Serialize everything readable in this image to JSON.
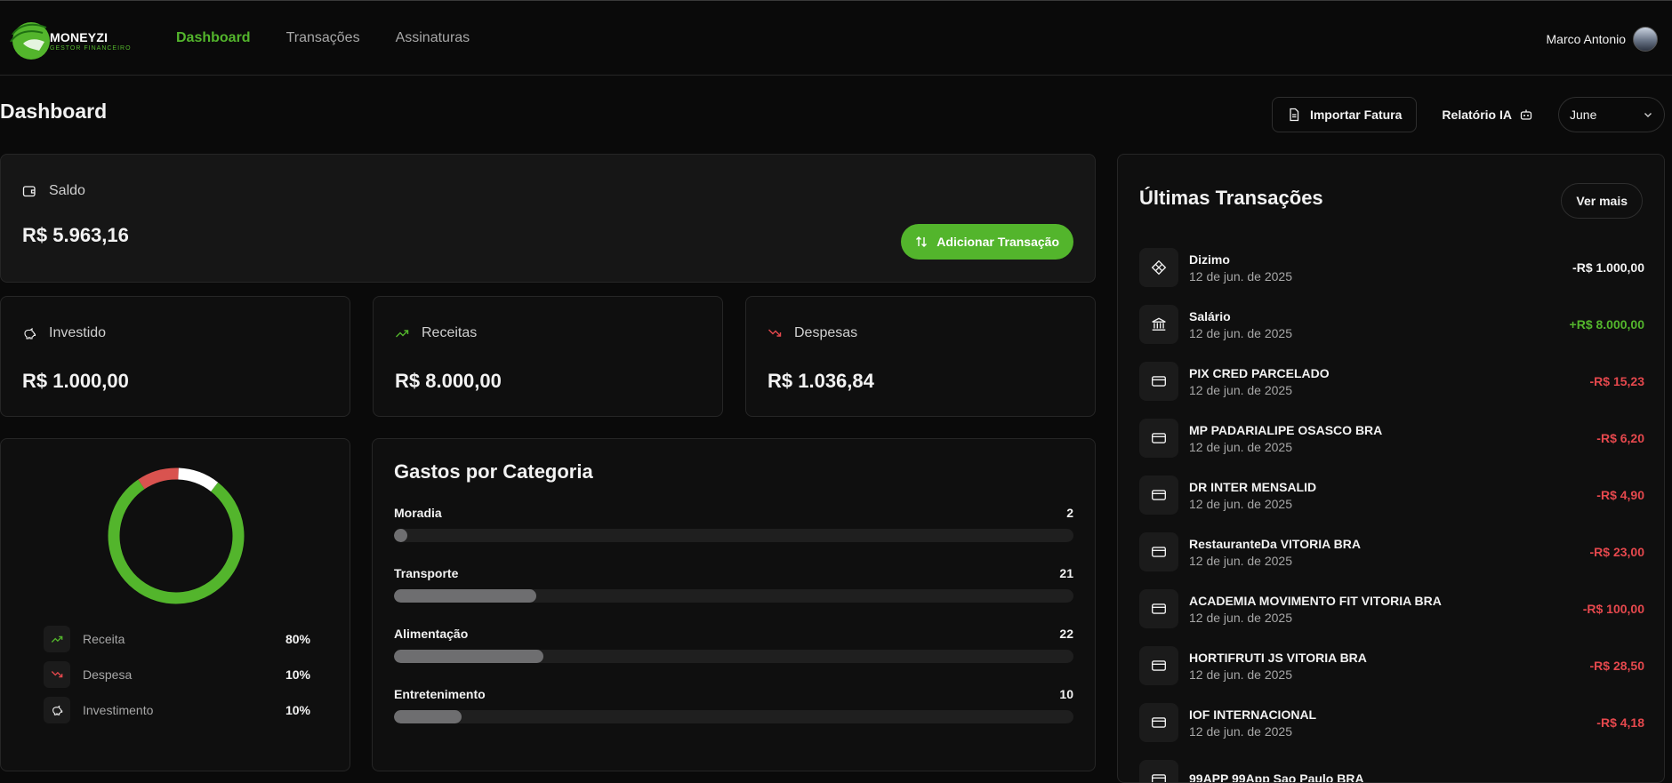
{
  "brand": {
    "name": "MONEYZI",
    "tagline": "GESTOR FINANCEIRO"
  },
  "nav": [
    {
      "label": "Dashboard",
      "active": true
    },
    {
      "label": "Transações",
      "active": false
    },
    {
      "label": "Assinaturas",
      "active": false
    }
  ],
  "user": {
    "name": "Marco Antonio"
  },
  "page": {
    "title": "Dashboard"
  },
  "actions": {
    "import_label": "Importar Fatura",
    "report_label": "Relatório IA",
    "month": "June"
  },
  "saldo": {
    "label": "Saldo",
    "amount": "R$ 5.963,16",
    "add_label": "Adicionar Transação"
  },
  "summary": [
    {
      "label": "Investido",
      "amount": "R$ 1.000,00",
      "icon": "piggy-bank-icon"
    },
    {
      "label": "Receitas",
      "amount": "R$ 8.000,00",
      "icon": "trending-up-icon"
    },
    {
      "label": "Despesas",
      "amount": "R$ 1.036,84",
      "icon": "trending-down-icon"
    }
  ],
  "distribution": {
    "legend": [
      {
        "label": "Receita",
        "value": "80%",
        "icon": "trending-up-icon"
      },
      {
        "label": "Despesa",
        "value": "10%",
        "icon": "trending-down-icon"
      },
      {
        "label": "Investimento",
        "value": "10%",
        "icon": "piggy-bank-icon"
      }
    ],
    "segments": [
      {
        "name": "Receita",
        "percent": 80,
        "color": "#53b52c"
      },
      {
        "name": "Despesa",
        "percent": 10,
        "color": "#d9534f"
      },
      {
        "name": "Investimento",
        "percent": 10,
        "color": "#ffffff"
      }
    ]
  },
  "categories": {
    "title": "Gastos por Categoria",
    "items": [
      {
        "name": "Moradia",
        "value": "2",
        "percent": 2
      },
      {
        "name": "Transporte",
        "value": "21",
        "percent": 21
      },
      {
        "name": "Alimentação",
        "value": "22",
        "percent": 22
      },
      {
        "name": "Entretenimento",
        "value": "10",
        "percent": 10
      }
    ]
  },
  "transactions": {
    "title": "Últimas Transações",
    "more_label": "Ver mais",
    "items": [
      {
        "name": "Dizimo",
        "date": "12 de jun. de 2025",
        "amount": "-R$ 1.000,00",
        "type": "neutral",
        "icon": "diamond-icon"
      },
      {
        "name": "Salário",
        "date": "12 de jun. de 2025",
        "amount": "+R$ 8.000,00",
        "type": "income",
        "icon": "bank-icon"
      },
      {
        "name": "PIX CRED PARCELADO",
        "date": "12 de jun. de 2025",
        "amount": "-R$ 15,23",
        "type": "expense",
        "icon": "credit-card-icon"
      },
      {
        "name": "MP PADARIALIPE OSASCO BRA",
        "date": "12 de jun. de 2025",
        "amount": "-R$ 6,20",
        "type": "expense",
        "icon": "credit-card-icon"
      },
      {
        "name": "DR INTER MENSALID",
        "date": "12 de jun. de 2025",
        "amount": "-R$ 4,90",
        "type": "expense",
        "icon": "credit-card-icon"
      },
      {
        "name": "RestauranteDa VITORIA BRA",
        "date": "12 de jun. de 2025",
        "amount": "-R$ 23,00",
        "type": "expense",
        "icon": "credit-card-icon"
      },
      {
        "name": "ACADEMIA MOVIMENTO FIT VITORIA BRA",
        "date": "12 de jun. de 2025",
        "amount": "-R$ 100,00",
        "type": "expense",
        "icon": "credit-card-icon"
      },
      {
        "name": "HORTIFRUTI JS VITORIA BRA",
        "date": "12 de jun. de 2025",
        "amount": "-R$ 28,50",
        "type": "expense",
        "icon": "credit-card-icon"
      },
      {
        "name": "IOF INTERNACIONAL",
        "date": "12 de jun. de 2025",
        "amount": "-R$ 4,18",
        "type": "expense",
        "icon": "credit-card-icon"
      },
      {
        "name": "99APP 99App Sao Paulo BRA",
        "date": "",
        "amount": "",
        "type": "expense",
        "icon": "credit-card-icon"
      }
    ]
  },
  "colors": {
    "accent": "#53b52c",
    "expense": "#e5484d",
    "income": "#53b52c",
    "background": "#0a0a0a",
    "card": "#0f0f0f"
  }
}
